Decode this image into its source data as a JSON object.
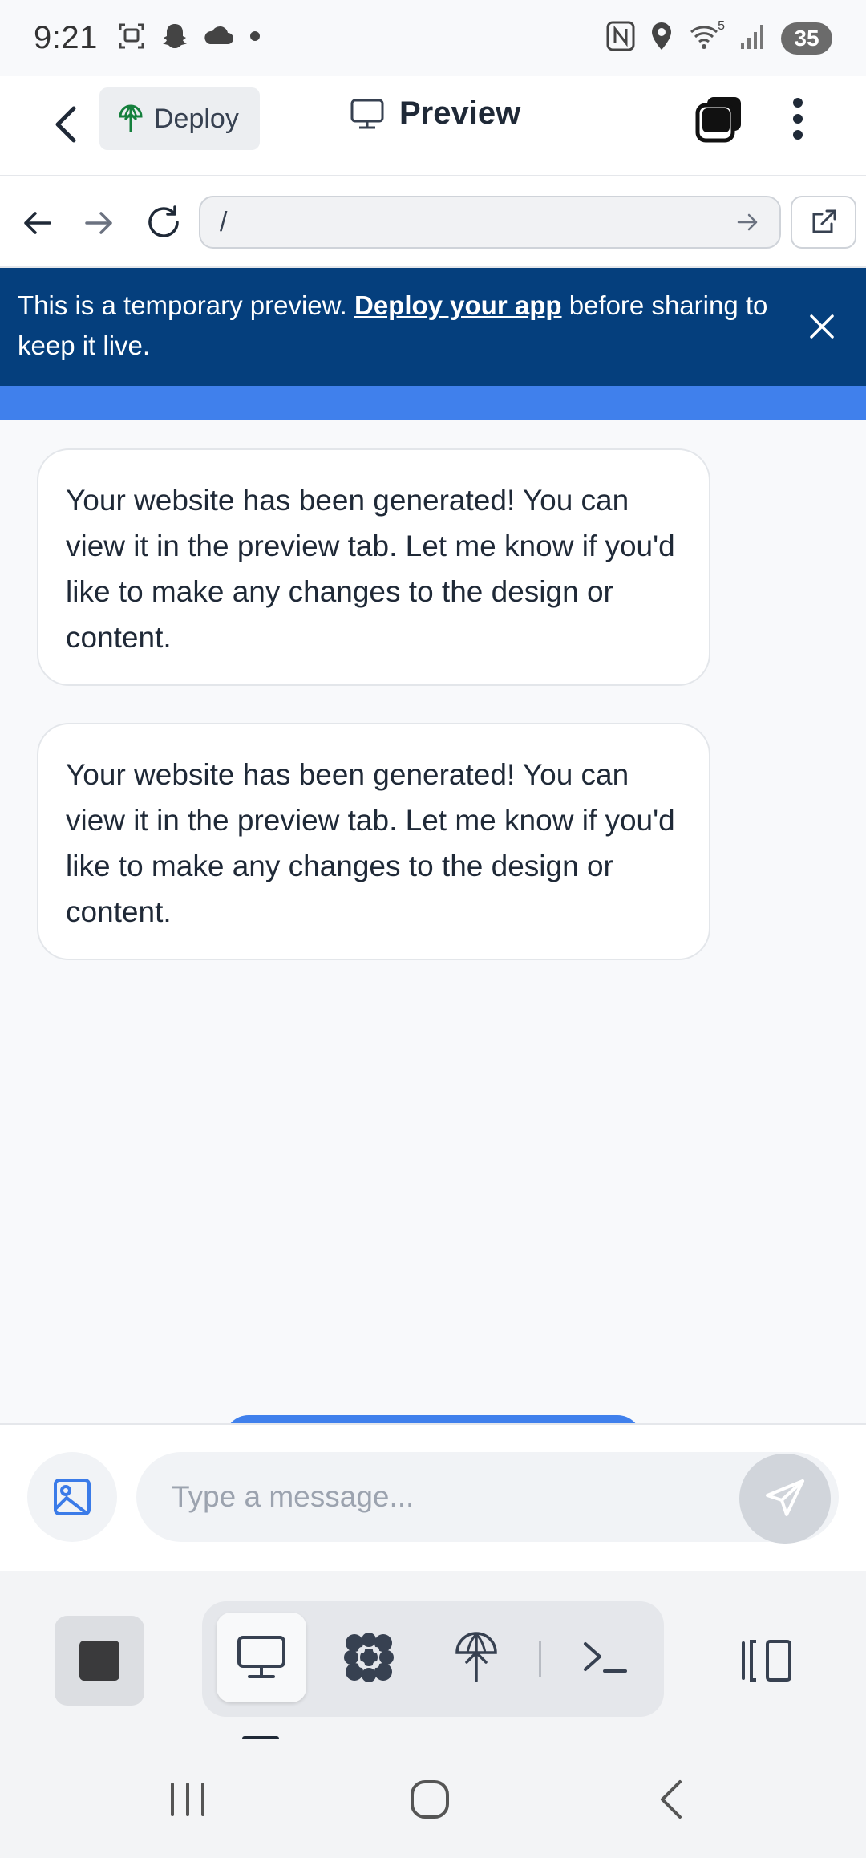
{
  "status_bar": {
    "time": "9:21",
    "battery": "35",
    "wifi_badge": "5"
  },
  "header": {
    "deploy_label": "Deploy",
    "preview_label": "Preview"
  },
  "browser": {
    "url": "/"
  },
  "banner": {
    "text_before": "This is a temporary preview. ",
    "link": "Deploy your app",
    "text_after": " before sharing to keep it live."
  },
  "messages": [
    {
      "text": "Your website has been generated! You can view it in the preview tab. Let me know if you'd like to make any changes to the design or content."
    },
    {
      "text": "Your website has been generated! You can view it in the preview tab. Let me know if you'd like to make any changes to the design or content."
    }
  ],
  "composer": {
    "placeholder": "Type a message..."
  },
  "colors": {
    "banner_bg": "#053f7d",
    "accent_blue": "#4080ec",
    "send_disabled": "#d1d5db"
  },
  "icons": {
    "status": [
      "screenshot-icon",
      "snapchat-icon",
      "cloud-icon",
      "dot-icon",
      "nfc-icon",
      "location-icon",
      "wifi-icon",
      "signal-icon"
    ],
    "toolbar": [
      "stop-icon",
      "desktop-icon",
      "agent-icon",
      "deploy-icon",
      "terminal-icon",
      "panel-icon"
    ]
  }
}
